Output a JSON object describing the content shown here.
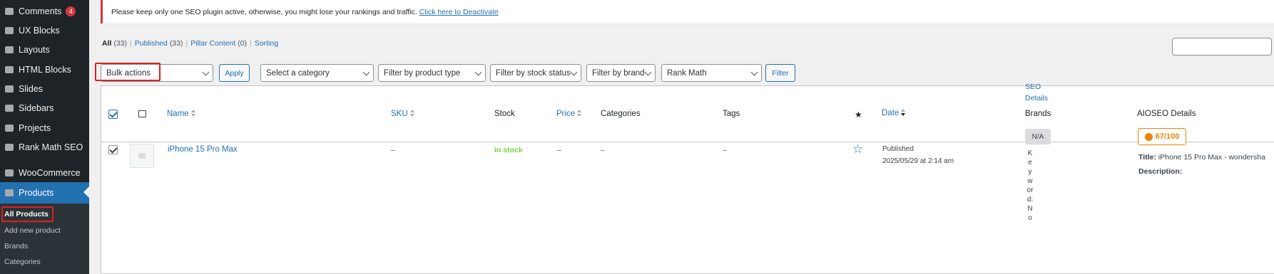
{
  "sidebar": {
    "items": [
      {
        "label": "Comments",
        "badge": "4",
        "icon": "comment-icon"
      },
      {
        "label": "UX Blocks",
        "icon": "grid-icon"
      },
      {
        "label": "Layouts",
        "icon": "layout-icon"
      },
      {
        "label": "HTML Blocks",
        "icon": "html-icon"
      },
      {
        "label": "Slides",
        "icon": "slides-icon"
      },
      {
        "label": "Sidebars",
        "icon": "sidebar-icon"
      },
      {
        "label": "Projects",
        "icon": "projects-icon"
      },
      {
        "label": "Rank Math SEO",
        "icon": "chart-icon"
      },
      {
        "label": "WooCommerce",
        "icon": "woo-icon"
      },
      {
        "label": "Products",
        "icon": "bag-icon"
      }
    ],
    "submenu": [
      {
        "label": "All Products"
      },
      {
        "label": "Add new product"
      },
      {
        "label": "Brands"
      },
      {
        "label": "Categories"
      }
    ]
  },
  "notice": {
    "text": "Please keep only one SEO plugin active, otherwise, you might lose your rankings and traffic.",
    "link": "Click here to Deactivate"
  },
  "views": {
    "all": "All",
    "all_count": "(33)",
    "published": "Published",
    "published_count": "(33)",
    "pillar": "Pillar Content",
    "pillar_count": "(0)",
    "sorting": "Sorting",
    "sep": "|"
  },
  "filters": {
    "bulk": "Bulk actions",
    "apply": "Apply",
    "category": "Select a category",
    "product_type": "Filter by product type",
    "stock_status": "Filter by stock status",
    "brand": "Filter by brand",
    "rank_math": "Rank Math",
    "filter": "Filter"
  },
  "columns": {
    "name": "Name",
    "sku": "SKU",
    "stock": "Stock",
    "price": "Price",
    "categories": "Categories",
    "tags": "Tags",
    "date": "Date",
    "seo_details": "SEO Details",
    "brands": "Brands",
    "aioseo": "AIOSEO Details"
  },
  "rows": [
    {
      "name": "iPhone 15 Pro Max",
      "sku": "–",
      "stock": "In stock",
      "price": "–",
      "categories": "–",
      "tags": "–",
      "date_status": "Published",
      "date_value": "2025/05/29 at 2:14 am",
      "seo_badge": "N/A",
      "seo_keyword": "Keyword: No",
      "aioseo_score": "67/100",
      "aioseo_title_label": "Title:",
      "aioseo_title": "iPhone 15 Pro Max - wondersha",
      "aioseo_desc_label": "Description:"
    }
  ],
  "colors": {
    "accent": "#2271b1",
    "sidebar": "#1d2327",
    "in_stock": "#7ad03a",
    "score": "#f18200",
    "highlight": "#e02020"
  }
}
